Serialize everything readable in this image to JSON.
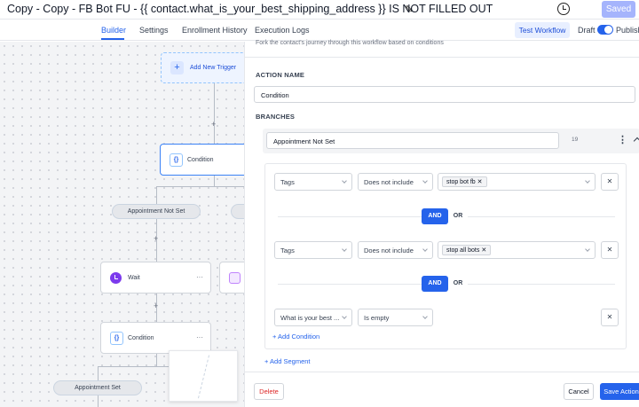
{
  "header": {
    "title": "Copy - Copy - FB Bot FU - {{ contact.what_is_your_best_shipping_address }} IS NOT FILLED OUT",
    "saved_label": "Saved"
  },
  "nav": {
    "tabs": [
      {
        "label": "Builder",
        "active": true
      },
      {
        "label": "Settings",
        "active": false
      },
      {
        "label": "Enrollment History",
        "active": false
      },
      {
        "label": "Execution Logs",
        "active": false
      }
    ],
    "test_workflow_label": "Test Workflow",
    "draft_label": "Draft",
    "publish_label": "Publish",
    "publish_toggle_on": true
  },
  "canvas": {
    "trigger_label": "Add New Trigger",
    "nodes": [
      {
        "label": "Condition"
      },
      {
        "label": "Wait"
      },
      {
        "label": "Condition"
      }
    ],
    "branch_pills": [
      "Appointment Not Set",
      "Appointment Set"
    ]
  },
  "panel": {
    "description": "Fork the contact's journey through this workflow based on conditions",
    "action_name_label": "ACTION NAME",
    "action_name_value": "Condition",
    "branches_label": "BRANCHES",
    "branch": {
      "name": "Appointment Not Set",
      "char_count": "19",
      "conditions": [
        {
          "field": "Tags",
          "operator": "Does not include",
          "value": "stop bot fb"
        },
        {
          "field": "Tags",
          "operator": "Does not include",
          "value": "stop all bots"
        },
        {
          "field": "What is your best ...",
          "operator": "Is empty",
          "value": ""
        }
      ],
      "and_label": "AND",
      "or_label": "OR",
      "add_condition_label": "+ Add Condition"
    },
    "add_segment_label": "+ Add Segment",
    "delete_label": "Delete",
    "cancel_label": "Cancel",
    "save_label": "Save Action"
  },
  "colors": {
    "accent": "#2563eb",
    "saved_disabled": "#a5b4fc",
    "delete": "#dc2626",
    "wait_icon": "#7c3aed"
  },
  "icons": {
    "edit": "pencil-icon",
    "history": "history-icon",
    "remove": "close-icon",
    "menu": "kebab-icon",
    "collapse": "chevron-up-icon"
  }
}
